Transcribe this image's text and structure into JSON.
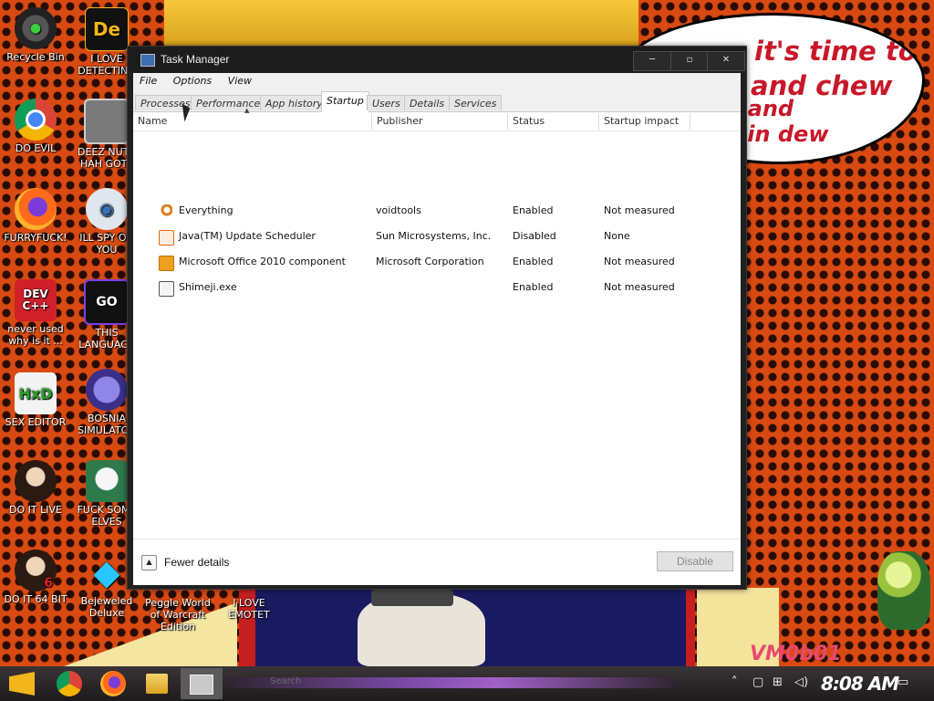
{
  "desktop": {
    "speech_bubble": {
      "line1": "it's time to eat shit",
      "line2": "and chew",
      "line3": "s and",
      "line4": "ain dew"
    },
    "watermark": "VM0b01",
    "icons": [
      {
        "label": "Recycle Bin"
      },
      {
        "label": "I LOVE DETECTING"
      },
      {
        "label": "DO EVIL"
      },
      {
        "label": "DEEZ NUTZ HAH GOTT"
      },
      {
        "label": "FURRYFUCK!"
      },
      {
        "label": "ILL SPY ON YOU"
      },
      {
        "label": "never used why is it ..."
      },
      {
        "label": "THIS LANGUAGE"
      },
      {
        "label": "SEX EDITOR"
      },
      {
        "label": "BOSNIA SIMULATOR"
      },
      {
        "label": "DO IT LIVE"
      },
      {
        "label": "FUCK SOME ELVES"
      },
      {
        "label": "DO IT 64 BIT"
      },
      {
        "label": "Bejeweled Deluxe"
      },
      {
        "label": "Peggle World of Warcraft Edition"
      },
      {
        "label": "I LOVE EMOTET"
      }
    ]
  },
  "task_manager": {
    "title": "Task Manager",
    "window_controls": {
      "minimize": "─",
      "maximize": "▫",
      "close": "✕"
    },
    "menu": [
      "File",
      "Options",
      "View"
    ],
    "tabs": [
      "Processes",
      "Performance",
      "App history",
      "Startup",
      "Users",
      "Details",
      "Services"
    ],
    "active_tab": "Startup",
    "columns": [
      "Name",
      "Publisher",
      "Status",
      "Startup impact"
    ],
    "rows": [
      {
        "name": "Everything",
        "publisher": "voidtools",
        "status": "Enabled",
        "impact": "Not measured",
        "icon": "magnifier-icon",
        "icon_color": "#e07a18"
      },
      {
        "name": "Java(TM) Update Scheduler",
        "publisher": "Sun Microsystems, Inc.",
        "status": "Disabled",
        "impact": "None",
        "icon": "java-icon",
        "icon_color": "#e06a10"
      },
      {
        "name": "Microsoft Office 2010 component",
        "publisher": "Microsoft Corporation",
        "status": "Enabled",
        "impact": "Not measured",
        "icon": "office-icon",
        "icon_color": "#f0a020"
      },
      {
        "name": "Shimeji.exe",
        "publisher": "",
        "status": "Enabled",
        "impact": "Not measured",
        "icon": "exe-icon",
        "icon_color": "#dcdcdc"
      }
    ],
    "footer": {
      "fewer_details": "Fewer details",
      "disable": "Disable"
    }
  },
  "taskbar": {
    "search_hint": "Search",
    "clock": "8:08 AM",
    "accent": "#a061c7"
  }
}
